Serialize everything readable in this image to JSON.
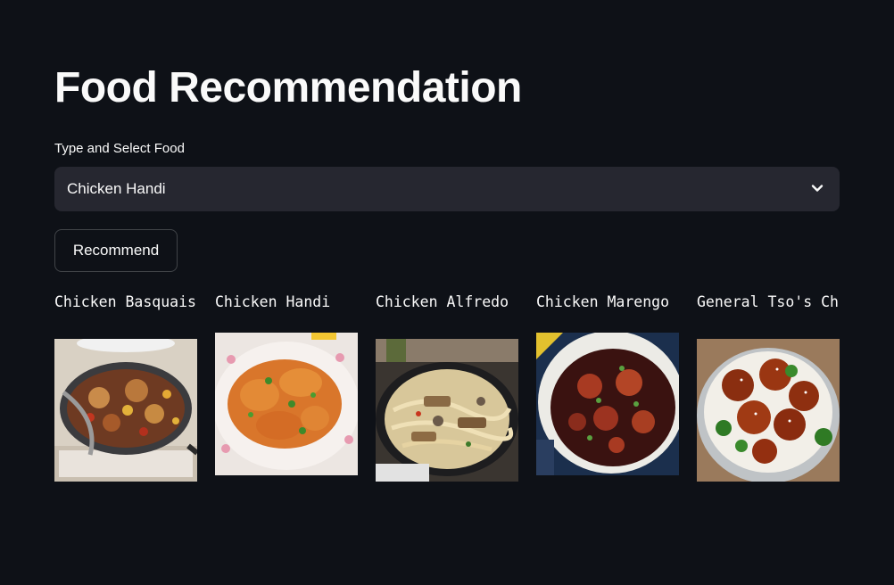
{
  "page": {
    "title": "Food Recommendation"
  },
  "selector": {
    "label": "Type and Select Food",
    "value": "Chicken Handi",
    "icon": "chevron-down-icon"
  },
  "recommend_button": {
    "label": "Recommend"
  },
  "recommendations": [
    {
      "name": "Chicken Basquaise",
      "image": "chicken-basquaise-photo"
    },
    {
      "name": "Chicken Handi",
      "image": "chicken-handi-photo"
    },
    {
      "name": "Chicken Alfredo",
      "image": "chicken-alfredo-photo"
    },
    {
      "name": "Chicken Marengo",
      "image": "chicken-marengo-photo"
    },
    {
      "name": "General Tso's Chicken",
      "image": "general-tsos-chicken-photo"
    }
  ],
  "colors": {
    "background": "#0e1117",
    "select_bg": "#262730",
    "text": "#fafafa"
  }
}
